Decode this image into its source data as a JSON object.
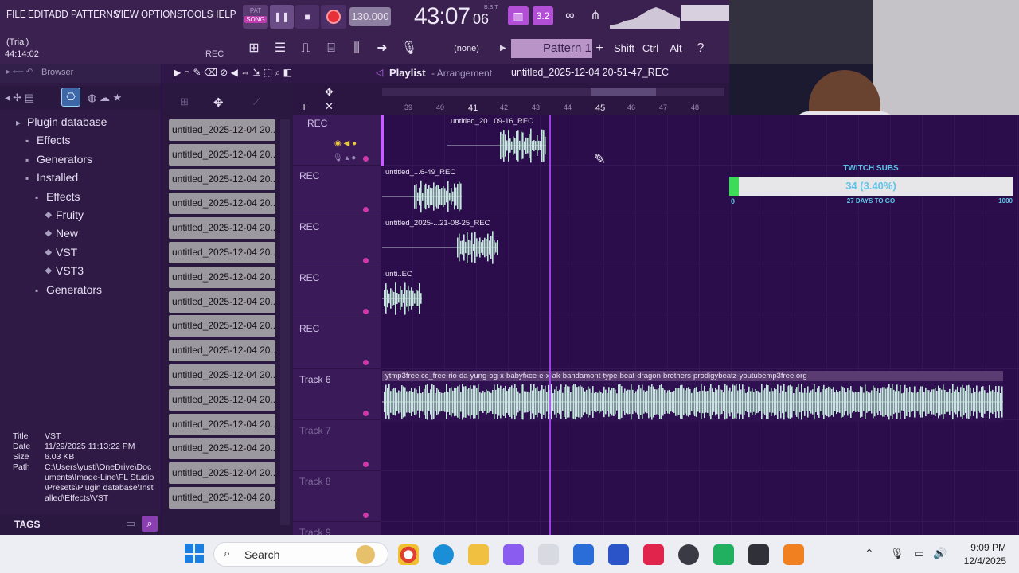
{
  "menu": [
    "FILE",
    "EDIT",
    "ADD",
    "PATTERNS",
    "VIEW",
    "OPTIONS",
    "TOOLS",
    "HELP"
  ],
  "transport": {
    "mode_top": "PAT",
    "mode_bottom": "SONG",
    "tempo": "130.000",
    "time": "43:07",
    "time_small": "06",
    "time_label": "B:S:T"
  },
  "hint": {
    "line1": "(Trial)",
    "line2": "44:14:02",
    "rec": "REC"
  },
  "pattern": {
    "none_label": "(none)",
    "pattern_label": "Pattern 1",
    "shift": "Shift",
    "ctrl": "Ctrl",
    "alt": "Alt"
  },
  "browser": {
    "title": "Browser",
    "tree": [
      {
        "label": "Plugin database",
        "indent": 0
      },
      {
        "label": "Effects",
        "indent": 1
      },
      {
        "label": "Generators",
        "indent": 1
      },
      {
        "label": "Installed",
        "indent": 1
      },
      {
        "label": "Effects",
        "indent": 2
      },
      {
        "label": "Fruity",
        "indent": 3
      },
      {
        "label": "New",
        "indent": 3
      },
      {
        "label": "VST",
        "indent": 3
      },
      {
        "label": "VST3",
        "indent": 3
      },
      {
        "label": "Generators",
        "indent": 2
      }
    ],
    "info": {
      "title_k": "Title",
      "title_v": "VST",
      "date_k": "Date",
      "date_v": "11/29/2025 11:13:22 PM",
      "size_k": "Size",
      "size_v": "6.03 KB",
      "path_k": "Path",
      "path_v": "C:\\Users\\yusti\\OneDrive\\Documents\\Image-Line\\FL Studio\\Presets\\Plugin database\\Installed\\Effects\\VST"
    },
    "tags": "TAGS"
  },
  "files": [
    "untitled_2025-12-04 20..",
    "untitled_2025-12-04 20..",
    "untitled_2025-12-04 20..",
    "untitled_2025-12-04 20..",
    "untitled_2025-12-04 20..",
    "untitled_2025-12-04 20..",
    "untitled_2025-12-04 20..",
    "untitled_2025-12-04 20..",
    "untitled_2025-12-04 20..",
    "untitled_2025-12-04 20..",
    "untitled_2025-12-04 20..",
    "untitled_2025-12-04 20..",
    "untitled_2025-12-04 20..",
    "untitled_2025-12-04 20..",
    "untitled_2025-12-04 20..",
    "untitled_2025-12-04 20.."
  ],
  "playlist": {
    "title": "Playlist",
    "sub": "- Arrangement",
    "file": "untitled_2025-12-04 20-51-47_REC",
    "ruler": [
      "39",
      "40",
      "41",
      "42",
      "43",
      "44",
      "45",
      "46",
      "47",
      "48"
    ]
  },
  "tracks": [
    {
      "name": "REC",
      "dim": false
    },
    {
      "name": "REC",
      "dim": false
    },
    {
      "name": "REC",
      "dim": false
    },
    {
      "name": "REC",
      "dim": false
    },
    {
      "name": "REC",
      "dim": false
    },
    {
      "name": "Track 6",
      "dim": false
    },
    {
      "name": "Track 7",
      "dim": true
    },
    {
      "name": "Track 8",
      "dim": true
    },
    {
      "name": "Track 9",
      "dim": true
    }
  ],
  "clips": [
    {
      "label": "untitled_20...09-16_REC"
    },
    {
      "label": "untitled_...6-49_REC"
    },
    {
      "label": "untitled_2025-...21-08-25_REC"
    },
    {
      "label": "unti..EC"
    },
    {
      "label": "ytmp3free.cc_free-rio-da-yung-og-x-babyfxce-e-x-ak-bandamont-type-beat-dragon-brothers-prodigybeatz-youtubemp3free.org"
    }
  ],
  "subs": {
    "title": "TWITCH SUBS",
    "value": "34 (3.40%)",
    "progress": 0.034,
    "min": "0",
    "days": "27 DAYS TO GO",
    "max": "1000"
  },
  "taskbar": {
    "search": "Search",
    "time": "9:09 PM",
    "date": "12/4/2025"
  },
  "colors": {
    "accent": "#b04cff",
    "bg": "#2a0e48",
    "audio": "#c4e6dc"
  }
}
